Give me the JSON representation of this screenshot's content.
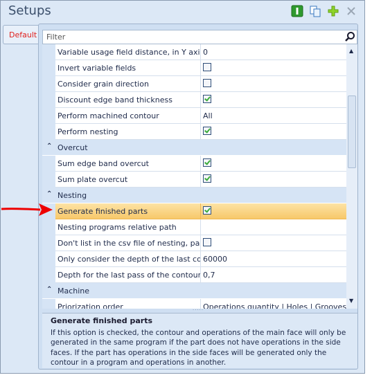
{
  "window": {
    "title": "Setups",
    "toolbar": [
      "info-icon",
      "copy-icon",
      "add-icon",
      "close-icon"
    ]
  },
  "tab": "Default",
  "filter": {
    "placeholder": "Filter"
  },
  "rows": [
    {
      "type": "prop",
      "label": "Variable usage field distance, in Y axis",
      "value": "0"
    },
    {
      "type": "prop",
      "label": "Invert variable fields",
      "check": false
    },
    {
      "type": "prop",
      "label": "Consider grain direction",
      "check": false
    },
    {
      "type": "prop",
      "label": "Discount edge band thickness",
      "check": true
    },
    {
      "type": "prop",
      "label": "Perform machined contour",
      "value": "All"
    },
    {
      "type": "prop",
      "label": "Perform nesting",
      "check": true
    },
    {
      "type": "cat",
      "label": "Overcut"
    },
    {
      "type": "prop",
      "label": "Sum edge band overcut",
      "check": true
    },
    {
      "type": "prop",
      "label": "Sum plate overcut",
      "check": true
    },
    {
      "type": "cat",
      "label": "Nesting"
    },
    {
      "type": "prop",
      "label": "Generate finished parts",
      "check": true,
      "selected": true
    },
    {
      "type": "prop",
      "label": "Nesting programs relative path",
      "value": ""
    },
    {
      "type": "prop",
      "label": "Don't list in the csv file of nesting, parts...",
      "check": false
    },
    {
      "type": "prop",
      "label": "Only consider the depth of the last con...",
      "value": "60000"
    },
    {
      "type": "prop",
      "label": "Depth for the last pass of the contour (...",
      "value": "0,7"
    },
    {
      "type": "cat",
      "label": "Machine"
    },
    {
      "type": "prop",
      "label": "Priorization order",
      "value": "Operations quantity | Holes | Grooves |"
    }
  ],
  "description": {
    "title": "Generate finished parts",
    "text": "If this option is checked, the contour and operations of the main face will only be generated in the same program if the part does not have operations in the side faces. If the part has operations in the side faces will be generated only the contour in a program and operations in another."
  },
  "colors": {
    "accent": "#e0201c",
    "selection": "#f7c86a"
  }
}
